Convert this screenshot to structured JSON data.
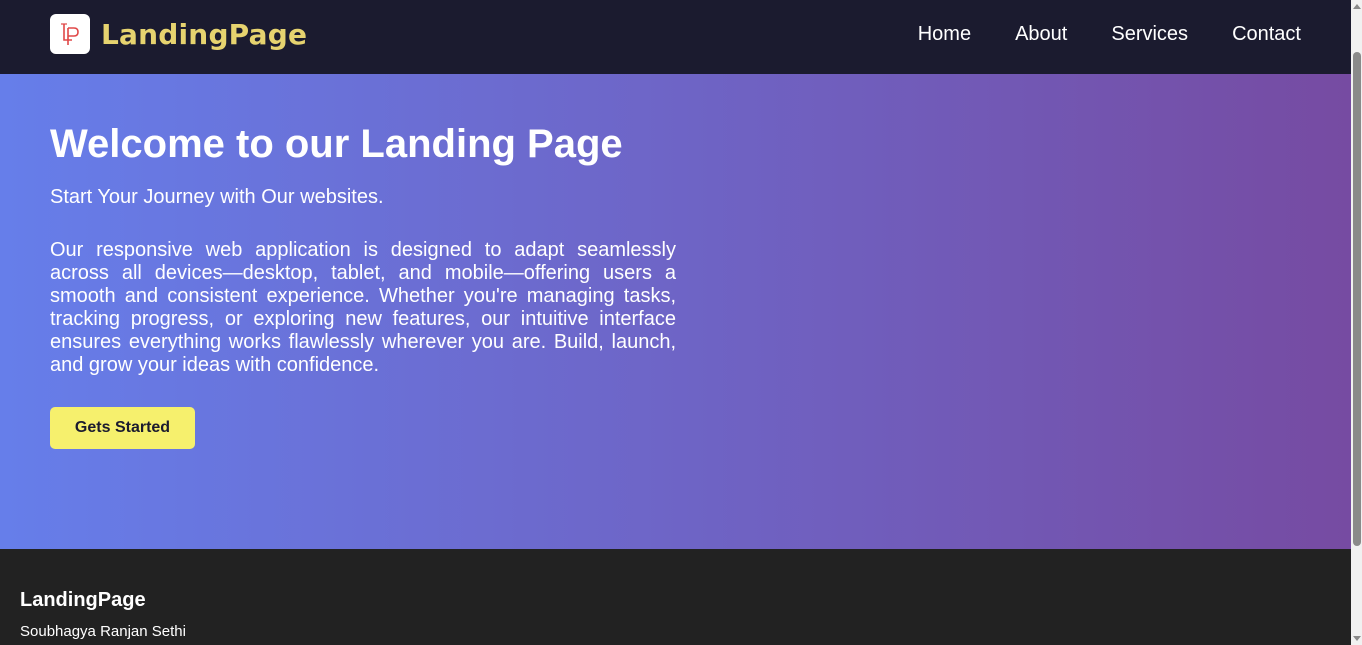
{
  "header": {
    "brand_name": "LandingPage",
    "logo_icon": "lp-monogram-logo",
    "nav": [
      {
        "label": "Home"
      },
      {
        "label": "About"
      },
      {
        "label": "Services"
      },
      {
        "label": "Contact"
      }
    ]
  },
  "hero": {
    "title": "Welcome to our Landing Page",
    "subtitle": "Start Your Journey with Our websites.",
    "body": "Our responsive web application is designed to adapt seamlessly across all devices—desktop, tablet, and mobile—offering users a smooth and consistent experience. Whether you're managing tasks, tracking progress, or exploring new features, our intuitive interface ensures everything works flawlessly wherever you are. Build, launch, and grow your ideas with confidence.",
    "cta_label": "Gets Started"
  },
  "footer": {
    "title": "LandingPage",
    "author": "Soubhagya Ranjan Sethi"
  },
  "colors": {
    "navbar_bg": "#1b1b2f",
    "brand": "#e6d36f",
    "gradient_start": "#667eea",
    "gradient_end": "#764ba2",
    "cta_bg": "#f6f06d",
    "footer_bg": "#222222"
  }
}
